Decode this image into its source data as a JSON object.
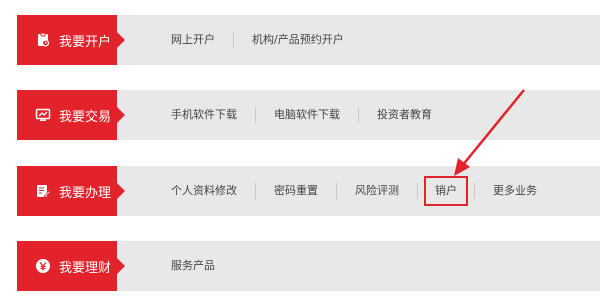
{
  "colors": {
    "accent": "#e3232c",
    "row_bg": "#e8e8e8",
    "link_text": "#444444"
  },
  "sections": [
    {
      "title": "我要开户",
      "icon": "clipboard-icon",
      "links": [
        "网上开户",
        "机构/产品预约开户"
      ]
    },
    {
      "title": "我要交易",
      "icon": "monitor-icon",
      "links": [
        "手机软件下载",
        "电脑软件下载",
        "投资者教育"
      ]
    },
    {
      "title": "我要办理",
      "icon": "edit-document-icon",
      "links": [
        "个人资料修改",
        "密码重置",
        "风险评测",
        "销户",
        "更多业务"
      ],
      "highlighted_link": "销户"
    },
    {
      "title": "我要理财",
      "icon": "yen-coin-icon",
      "links": [
        "服务产品"
      ]
    }
  ],
  "annotation": {
    "icon": "red-arrow-icon"
  }
}
